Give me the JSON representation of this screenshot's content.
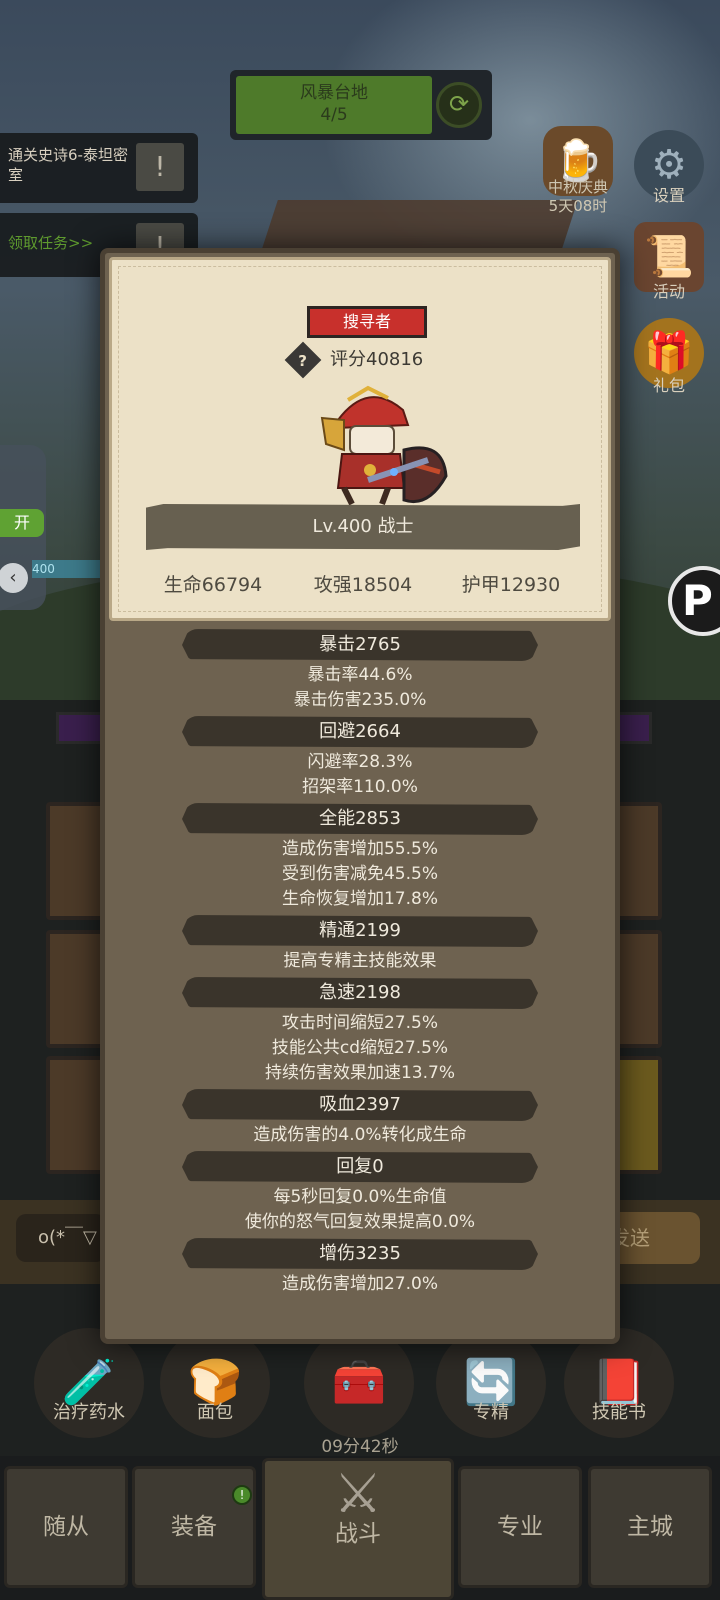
{
  "stage": {
    "name": "风暴台地",
    "progress": "4/5",
    "refresh_icon": "refresh-icon"
  },
  "quests": {
    "q1": "通关史诗6-泰坦密室",
    "q2": "领取任务>>"
  },
  "side_icons": {
    "festival": {
      "label": "中秋庆典",
      "timer": "5天08时"
    },
    "settings": "设置",
    "activity": "活动",
    "gift": "礼包"
  },
  "left_panel": {
    "toggle": "开",
    "level_tag": "400"
  },
  "modal": {
    "title": "搜寻者",
    "rating": "评分40816",
    "level_class": "Lv.400 战士",
    "main_stats": {
      "hp": "生命66794",
      "attack": "攻强18504",
      "armor": "护甲12930"
    },
    "groups": [
      {
        "head": "暴击2765",
        "lines": [
          "暴击率44.6%",
          "暴击伤害235.0%"
        ]
      },
      {
        "head": "回避2664",
        "lines": [
          "闪避率28.3%",
          "招架率110.0%"
        ]
      },
      {
        "head": "全能2853",
        "lines": [
          "造成伤害增加55.5%",
          "受到伤害减免45.5%",
          "生命恢复增加17.8%"
        ]
      },
      {
        "head": "精通2199",
        "lines": [
          "提高专精主技能效果"
        ]
      },
      {
        "head": "急速2198",
        "lines": [
          "攻击时间缩短27.5%",
          "技能公共cd缩短27.5%",
          "持续伤害效果加速13.7%"
        ]
      },
      {
        "head": "吸血2397",
        "lines": [
          "造成伤害的4.0%转化成生命"
        ]
      },
      {
        "head": "回复0",
        "lines": [
          "每5秒回复0.0%生命值",
          "使你的怒气回复效果提高0.0%"
        ]
      },
      {
        "head": "增伤3235",
        "lines": [
          "造成伤害增加27.0%"
        ]
      }
    ]
  },
  "chat": {
    "input": "o(*￣▽",
    "send": "发送"
  },
  "quick_slots": {
    "potion": "治疗药水",
    "bread": "面包",
    "timer": "09分42秒",
    "spec": "专精",
    "skillbook": "技能书"
  },
  "nav": {
    "followers": "随从",
    "equipment": "装备",
    "battle": "战斗",
    "profession": "专业",
    "city": "主城",
    "badge": "!"
  },
  "colors": {
    "title_badge": "#c8302c",
    "modal_bg": "#6e6250",
    "parchment": "#ece1c7",
    "stage_green": "#4e7a2a"
  }
}
